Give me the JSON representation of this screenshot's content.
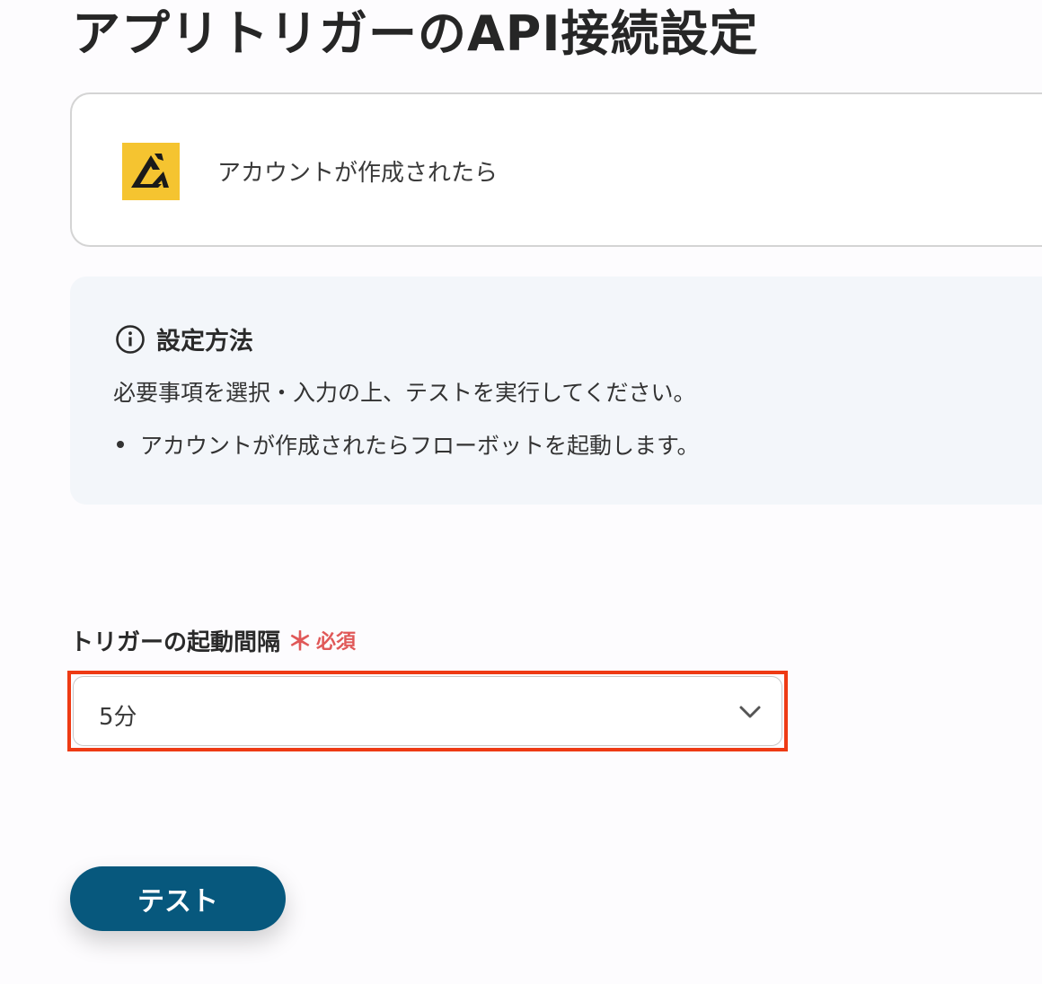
{
  "header": {
    "title": "アプリトリガーのAPI接続設定"
  },
  "trigger": {
    "app_icon": "app-logo-icon",
    "app_icon_color": "#f5c430",
    "label": "アカウントが作成されたら"
  },
  "info": {
    "icon": "info-circle-icon",
    "title": "設定方法",
    "description": "必要事項を選択・入力の上、テストを実行してください。",
    "bullets": [
      "アカウントが作成されたらフローボットを起動します。"
    ]
  },
  "interval_field": {
    "label": "トリガーの起動間隔",
    "required_mark": "＊",
    "required_label": "必須",
    "selected_value": "5分",
    "highlight_color": "#ee3a14"
  },
  "actions": {
    "test_label": "テスト",
    "test_color": "#07587d"
  }
}
